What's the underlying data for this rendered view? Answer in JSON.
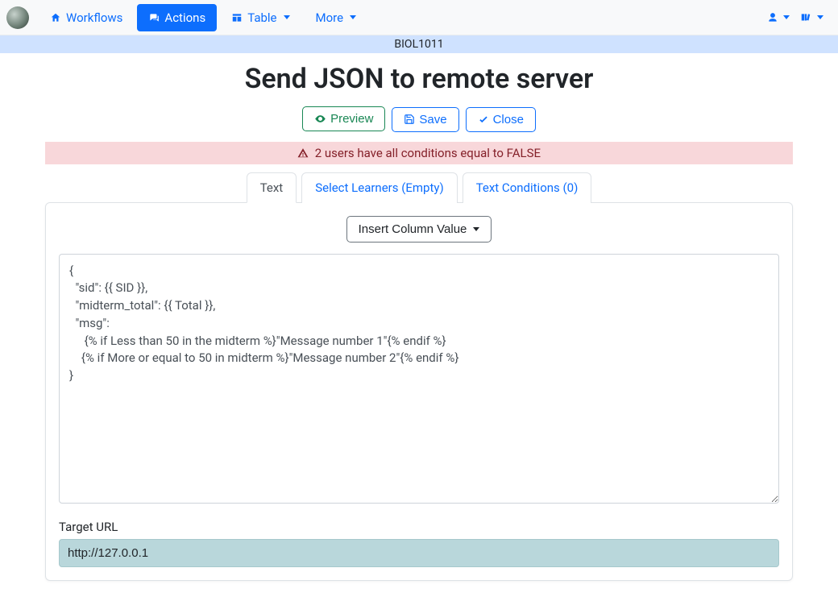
{
  "nav": {
    "workflows": "Workflows",
    "actions": "Actions",
    "table": "Table",
    "more": "More"
  },
  "context": "BIOL1011",
  "title": "Send JSON to remote server",
  "buttons": {
    "preview": "Preview",
    "save": "Save",
    "close": "Close"
  },
  "alert": "2 users have all conditions equal to FALSE",
  "tabs": {
    "text": "Text",
    "select_learners": "Select Learners (Empty)",
    "text_conditions": "Text Conditions (0)"
  },
  "editor": {
    "insert_column": "Insert Column Value",
    "body": "{\n  \"sid\": {{ SID }},\n  \"midterm_total\": {{ Total }},\n  \"msg\":\n     {% if Less than 50 in the midterm %}\"Message number 1\"{% endif %}\n    {% if More or equal to 50 in midterm %}\"Message number 2\"{% endif %}\n}"
  },
  "target_url": {
    "label": "Target URL",
    "value": "http://127.0.0.1"
  }
}
